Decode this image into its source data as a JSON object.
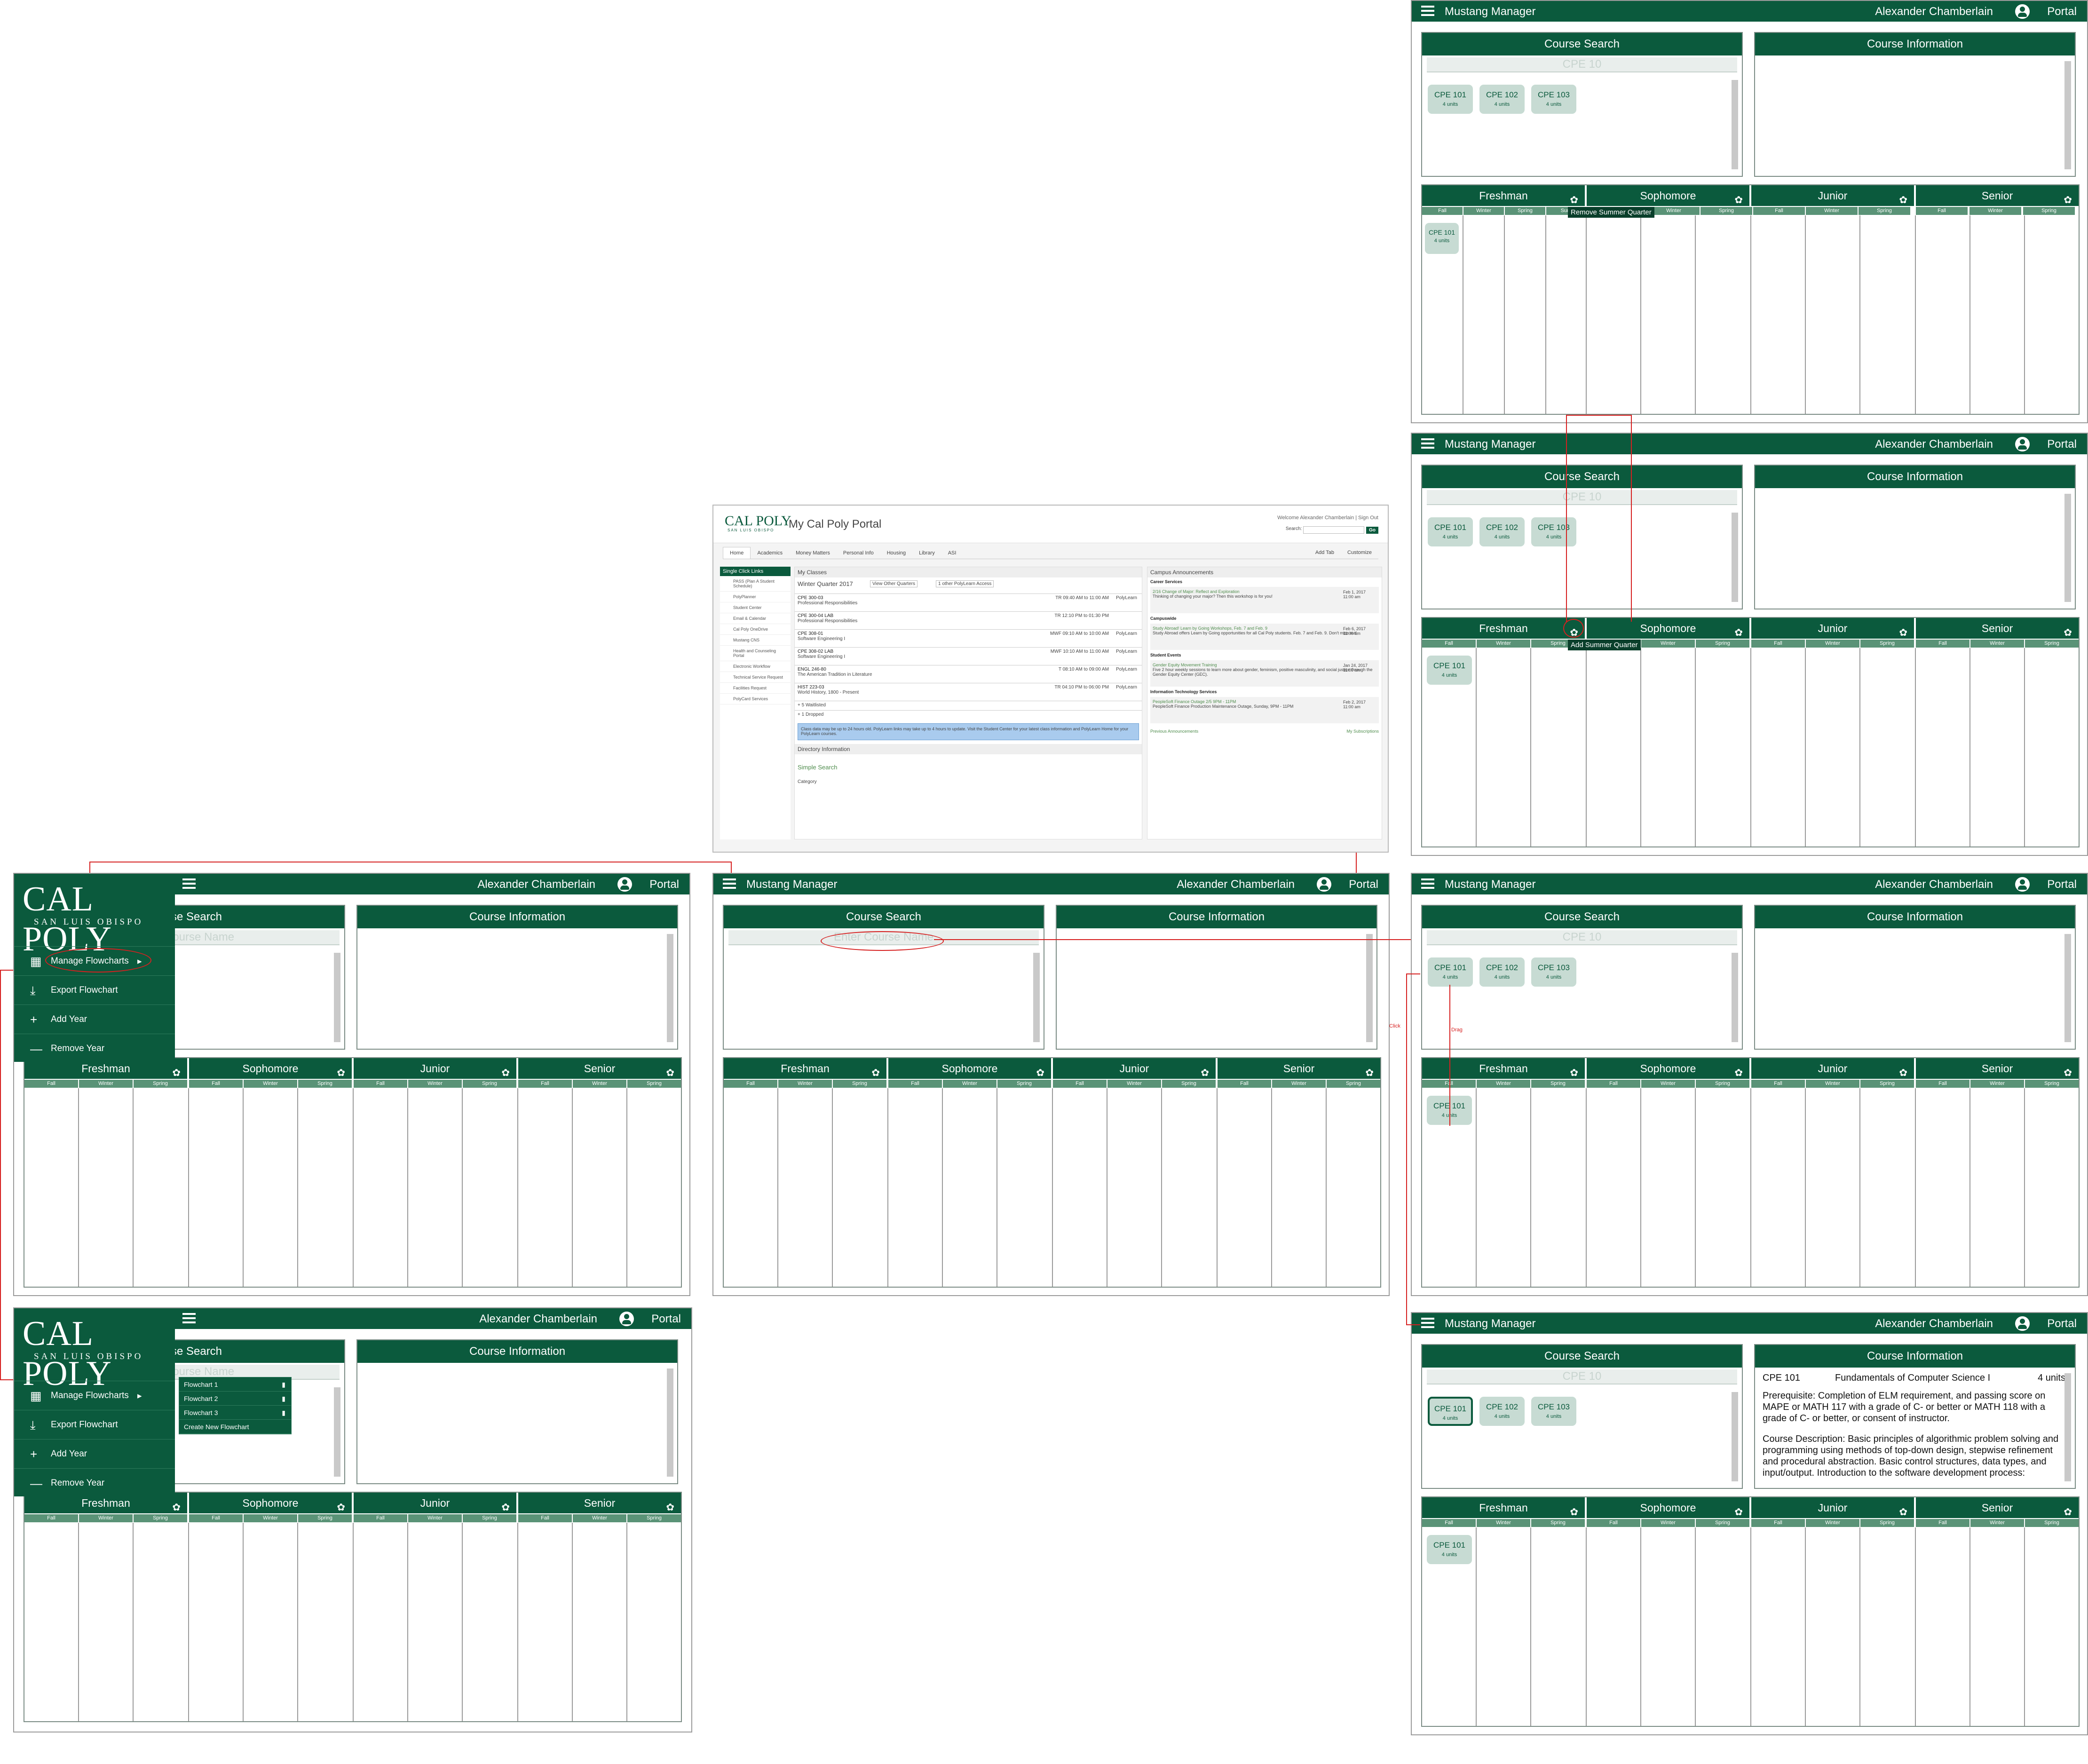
{
  "app": {
    "title": "Mustang Manager",
    "user": "Alexander Chamberlain",
    "portal": "Portal"
  },
  "panels": {
    "search": "Course Search",
    "info": "Course Information",
    "search_value": "CPE 10",
    "search_placeholder": "Enter Course Name"
  },
  "years": [
    "Freshman",
    "Sophomore",
    "Junior",
    "Senior"
  ],
  "quarters": [
    "Fall",
    "Winter",
    "Spring"
  ],
  "chips": [
    {
      "code": "CPE 101",
      "units": "4 units"
    },
    {
      "code": "CPE 102",
      "units": "4 units"
    },
    {
      "code": "CPE 103",
      "units": "4 units"
    }
  ],
  "tooltips": {
    "remove": "Remove Summer Quarter",
    "add": "Add Summer Quarter"
  },
  "annotations": {
    "click": "Click",
    "drag": "Drag"
  },
  "sidebar": {
    "logo": "CAL POLY",
    "logo_sub": "SAN LUIS OBISPO",
    "items": [
      "Manage Flowcharts",
      "Export Flowchart",
      "Add Year",
      "Remove Year"
    ]
  },
  "flowcharts": [
    "Flowchart 1",
    "Flowchart 2",
    "Flowchart 3",
    "Create New Flowchart"
  ],
  "course_info": {
    "code": "CPE 101",
    "name": "Fundamentals of Computer Science I",
    "units": "4 units",
    "prereq": "Prerequisite:  Completion of ELM requirement, and passing score on MAPE or MATH 117 with a grade of C- or better or MATH 118 with a grade of C- or better, or consent of instructor.",
    "desc": "Course Description: Basic principles of algorithmic problem solving and programming using methods of top-down design, stepwise refinement and procedural abstraction. Basic control structures, data types, and input/output. Introduction to the software development process:"
  },
  "portal_shot": {
    "logo": "CAL POLY",
    "logo_sub": "SAN LUIS OBISPO",
    "title": "My Cal Poly Portal",
    "welcome": "Welcome  Alexander Chamberlain  |  Sign Out",
    "search_label": "Search:",
    "go": "Go",
    "tabs": [
      "Home",
      "Academics",
      "Money Matters",
      "Personal Info",
      "Housing",
      "Library",
      "ASI"
    ],
    "side_header": "Single Click Links",
    "side_links": [
      "PASS (Plan A Student Schedule)",
      "PolyPlanner",
      "Student Center",
      "Email & Calendar",
      "Cal Poly OneDrive",
      "Mustang CNS",
      "Health and Counseling Portal",
      "Electronic Workflow",
      "Technical Service Request",
      "Facilities Request",
      "PolyCard Services"
    ],
    "classes_header": "My Classes",
    "quarter": "Winter Quarter 2017",
    "other_q": "View Other Quarters",
    "access": "1 other PolyLearn Access",
    "classes": [
      {
        "code": "CPE 300-03",
        "name": "Professional Responsibilities",
        "time": "TR 09:40 AM to 11:00 AM",
        "pl": "PolyLearn"
      },
      {
        "code": "CPE 300-04 LAB",
        "name": "Professional Responsibilities",
        "time": "TR 12:10 PM to 01:30 PM",
        "pl": ""
      },
      {
        "code": "CPE 308-01",
        "name": "Software Engineering I",
        "time": "MWF 09:10 AM to 10:00 AM",
        "pl": "PolyLearn"
      },
      {
        "code": "CPE 308-02 LAB",
        "name": "Software Engineering I",
        "time": "MWF 10:10 AM to 11:00 AM",
        "pl": "PolyLearn"
      },
      {
        "code": "ENGL 246-80",
        "name": "The American Tradition in Literature",
        "time": "T 08:10 AM to 09:00 AM",
        "pl": "PolyLearn"
      },
      {
        "code": "HIST 223-03",
        "name": "World History, 1800 - Present",
        "time": "TR 04:10 PM to 06:00 PM",
        "pl": "PolyLearn"
      }
    ],
    "waitlisted": "+ 5 Waitlisted",
    "dropped": "+ 1 Dropped",
    "note": "Class data may be up to 24 hours old. PolyLearn links may take up to 4 hours to update. Visit the Student Center for your latest class information and PolyLearn Home for your PolyLearn courses.",
    "dir_header": "Directory Information",
    "simple_search": "Simple Search",
    "category": "Category",
    "ann_header": "Campus Announcements",
    "ann": [
      {
        "sec": "Career Services",
        "title": "2/16 Change of Major: Reflect and Exploration",
        "body": "Thinking of changing your major? Then this workshop is for you!",
        "date": "Feb 1, 2017 11:00 am"
      },
      {
        "sec": "Campuswide",
        "title": "Study Abroad! Learn by Going Workshops, Feb. 7 and Feb. 9",
        "body": "Study Abroad offers Learn by Going opportunities for all Cal Poly students. Feb. 7 and Feb. 9. Don't miss out!",
        "date": "Feb 6, 2017 11:00 am"
      },
      {
        "sec": "Student Events",
        "title": "Gender Equity Movement Training",
        "body": "Five 2 hour weekly sessions to learn more about gender, feminism, positive masculinity, and social justice through the Gender Equity Center (GEC).",
        "date": "Jan 24, 2017 11:00 am"
      },
      {
        "sec": "Information Technology Services",
        "title": "PeopleSoft Finance Outage 2/5 9PM - 11PM",
        "body": "PeopleSoft Finance Production Maintenance Outage, Sunday, 9PM - 11PM",
        "date": "Feb 2, 2017 11:00 am"
      }
    ],
    "prev_ann": "Previous Announcements",
    "my_subs": "My Subscriptions",
    "add_tab": "Add Tab",
    "customize": "Customize"
  },
  "colors": {
    "brand": "#0b5a3d",
    "quarter_bar": "#5a9377",
    "chip": "#c7dbd3",
    "annotation": "#d62020"
  }
}
